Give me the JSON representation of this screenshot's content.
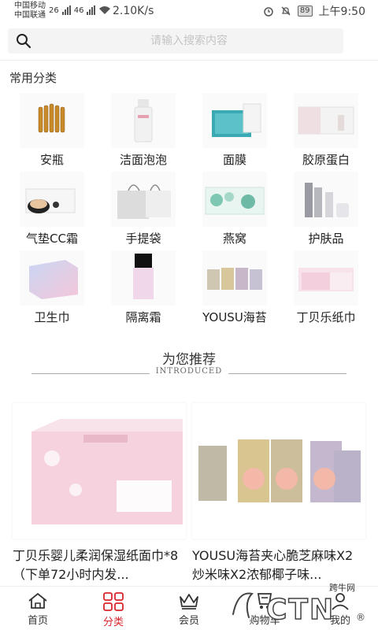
{
  "status_bar": {
    "carrier_1": "中国移动",
    "carrier_2": "中国联通",
    "network_1": "26",
    "network_2": "46",
    "speed": "2.10K/s",
    "battery": "89",
    "time": "上午9:50",
    "icons": [
      "alarm-icon",
      "mute-icon",
      "battery-icon",
      "wifi-icon",
      "signal-icon"
    ]
  },
  "search": {
    "placeholder": "请输入搜索内容",
    "value": ""
  },
  "categories": {
    "title": "常用分类",
    "items": [
      {
        "label": "安瓶",
        "icon": "ampoule-image"
      },
      {
        "label": "洁面泡泡",
        "icon": "cleanser-image"
      },
      {
        "label": "面膜",
        "icon": "mask-image"
      },
      {
        "label": "胶原蛋白",
        "icon": "collagen-image"
      },
      {
        "label": "气垫CC霜",
        "icon": "cushion-image"
      },
      {
        "label": "手提袋",
        "icon": "handbag-image"
      },
      {
        "label": "燕窝",
        "icon": "birdnest-image"
      },
      {
        "label": "护肤品",
        "icon": "skincare-image"
      },
      {
        "label": "卫生巾",
        "icon": "sanitary-pad-image"
      },
      {
        "label": "隔离霜",
        "icon": "primer-image"
      },
      {
        "label": "YOUSU海苔",
        "icon": "seaweed-image"
      },
      {
        "label": "丁贝乐纸巾",
        "icon": "tissue-image"
      }
    ]
  },
  "recommend": {
    "title": "为您推荐",
    "subtitle": "INTRODUCED",
    "products": [
      {
        "title": "丁贝乐婴儿柔润保湿纸面巾*8（下单72小时内发...",
        "image": "tissue-pack-image"
      },
      {
        "title": "YOUSU海苔夹心脆芝麻味X2炒米味X2浓郁椰子味...",
        "image": "seaweed-cans-image"
      }
    ]
  },
  "tabbar": {
    "items": [
      {
        "label": "首页",
        "icon": "home-icon",
        "active": false
      },
      {
        "label": "分类",
        "icon": "category-icon",
        "active": true
      },
      {
        "label": "会员",
        "icon": "crown-icon",
        "active": false
      },
      {
        "label": "购物车",
        "icon": "cart-icon",
        "active": false
      },
      {
        "label": "我的",
        "icon": "user-icon",
        "active": false
      }
    ]
  },
  "watermark": {
    "text": "跨牛网"
  },
  "colors": {
    "accent": "#d9262b",
    "text": "#222222",
    "placeholder": "#c4c4c4"
  }
}
